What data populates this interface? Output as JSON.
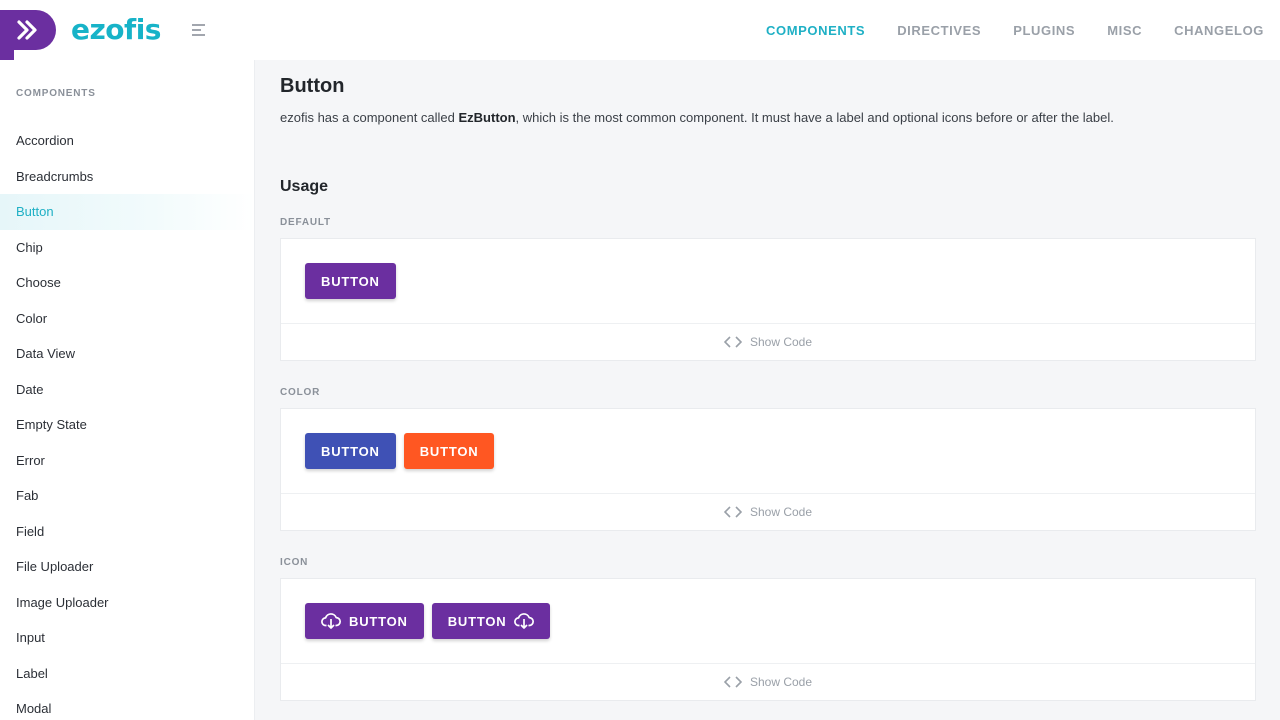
{
  "header": {
    "logo_text": "ezofis",
    "nav": [
      "COMPONENTS",
      "DIRECTIVES",
      "PLUGINS",
      "MISC",
      "CHANGELOG"
    ],
    "active_nav": "COMPONENTS"
  },
  "sidebar": {
    "heading": "COMPONENTS",
    "items": [
      "Accordion",
      "Breadcrumbs",
      "Button",
      "Chip",
      "Choose",
      "Color",
      "Data View",
      "Date",
      "Empty State",
      "Error",
      "Fab",
      "Field",
      "File Uploader",
      "Image Uploader",
      "Input",
      "Label",
      "Modal"
    ],
    "active_item": "Button"
  },
  "main": {
    "title": "Button",
    "intro_prefix": "ezofis has a component called ",
    "intro_bold": "EzButton",
    "intro_suffix": ", which is the most common component. It must have a label and optional icons before or after the label.",
    "usage_heading": "Usage",
    "show_code": "Show Code",
    "sections": [
      {
        "label": "DEFAULT",
        "buttons": [
          "BUTTON"
        ]
      },
      {
        "label": "COLOR",
        "buttons": [
          "BUTTON",
          "BUTTON"
        ]
      },
      {
        "label": "ICON",
        "buttons": [
          "BUTTON",
          "BUTTON"
        ]
      }
    ]
  },
  "colors": {
    "brand_purple": "#6b2fa0",
    "brand_teal": "#1fb0c5",
    "button_indigo": "#3f51b5",
    "button_orange": "#ff5722"
  },
  "icons": {
    "logo": "double-chevron-right-icon",
    "menu": "menu-lines-icon",
    "show_code": "code-brackets-icon",
    "icon_button": "cloud-download-icon"
  }
}
